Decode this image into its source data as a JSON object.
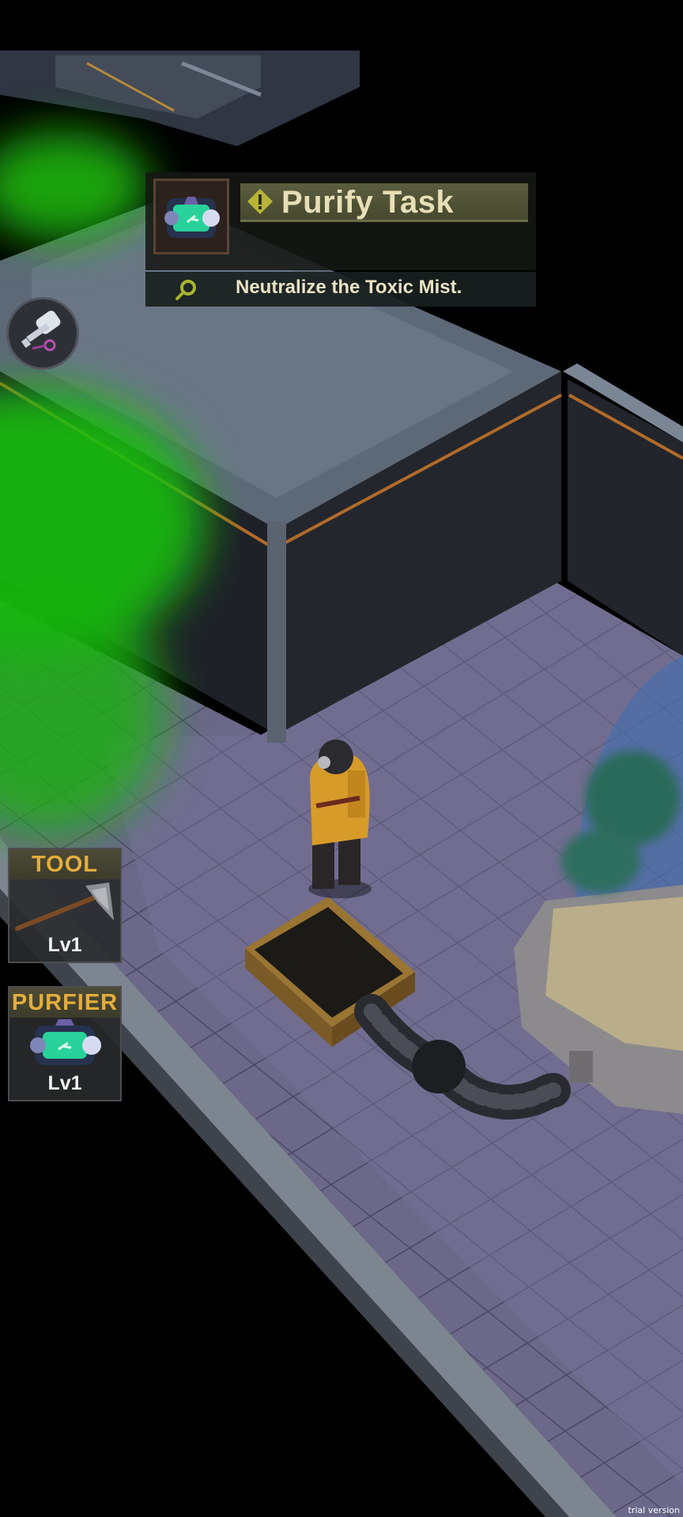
{
  "quest": {
    "title": "Purify Task",
    "description": "Neutralize the Toxic Mist.",
    "icon": "purifier-canister-icon",
    "status_icon": "alert-icon"
  },
  "hud": {
    "key_button_icon": "key-icon",
    "slots": [
      {
        "label": "TOOL",
        "level": "Lv1",
        "icon": "axe-icon"
      },
      {
        "label": "PURFIER",
        "level": "Lv1",
        "icon": "purifier-canister-icon"
      }
    ]
  },
  "watermark": "trial version",
  "colors": {
    "toxic_mist": "#19b50f",
    "floor": "#6e6a8c",
    "wall": "#2b2d35",
    "slot_label": "#e4ad3c",
    "quest_title": "#e7dfb6"
  }
}
